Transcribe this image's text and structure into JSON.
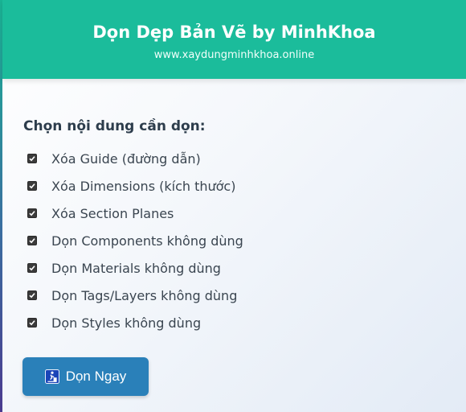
{
  "header": {
    "title": "Dọn Dẹp Bản Vẽ by MinhKhoa",
    "subtitle": "www.xaydungminhkhoa.online"
  },
  "options_section": {
    "heading": "Chọn nội dung cần dọn:",
    "options": [
      {
        "label": "Xóa Guide (đường dẫn)",
        "checked": true
      },
      {
        "label": "Xóa Dimensions (kích thước)",
        "checked": true
      },
      {
        "label": "Xóa Section Planes",
        "checked": true
      },
      {
        "label": "Dọn Components không dùng",
        "checked": true
      },
      {
        "label": "Dọn Materials không dùng",
        "checked": true
      },
      {
        "label": "Dọn Tags/Layers không dùng",
        "checked": true
      },
      {
        "label": "Dọn Styles không dùng",
        "checked": true
      }
    ]
  },
  "action": {
    "button_label": "Dọn Ngay",
    "button_icon": "trash-bin-icon"
  },
  "colors": {
    "header_bg": "#1bbc9b",
    "button_bg": "#2a80b9",
    "heading_text": "#2d3d4c",
    "body_text": "#3a4550",
    "icon_bg": "#1a45b8"
  }
}
